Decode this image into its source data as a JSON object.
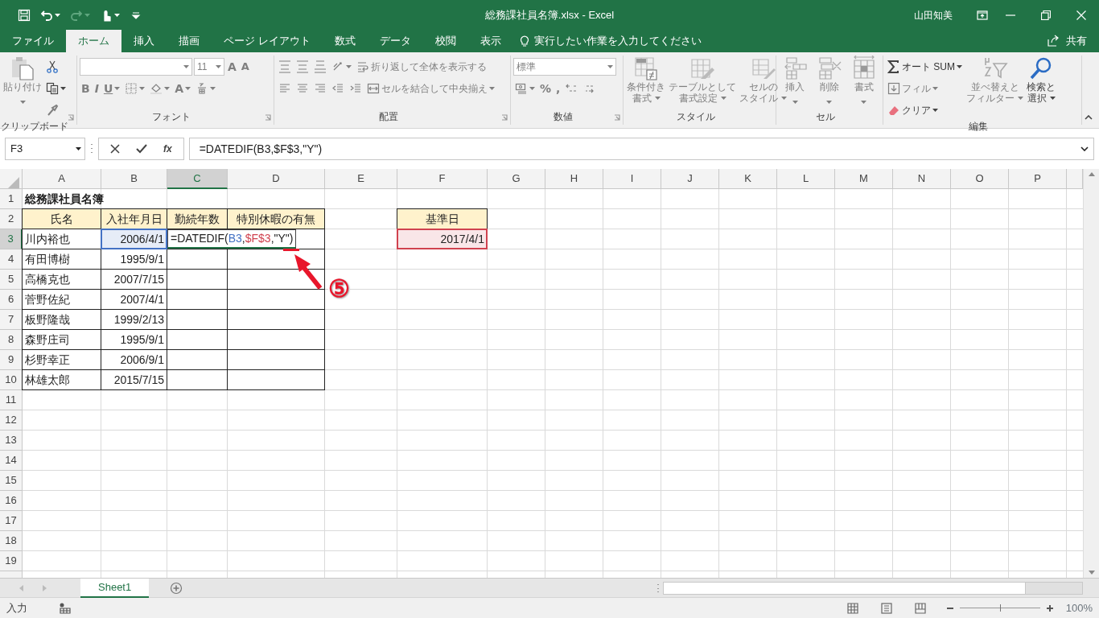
{
  "window": {
    "title": "総務課社員名簿.xlsx  -  Excel",
    "user": "山田知美"
  },
  "quick_access": [
    {
      "kind": "save",
      "disabled": false
    },
    {
      "kind": "undo",
      "dropdown": true,
      "disabled": false
    },
    {
      "kind": "redo",
      "dropdown": true,
      "disabled": true
    },
    {
      "kind": "touch",
      "dropdown": true,
      "disabled": false
    },
    {
      "kind": "customize",
      "disabled": false
    }
  ],
  "tabs": [
    {
      "label": "ファイル",
      "selected": false
    },
    {
      "label": "ホーム",
      "selected": true
    },
    {
      "label": "挿入",
      "selected": false
    },
    {
      "label": "描画",
      "selected": false
    },
    {
      "label": "ページ レイアウト",
      "selected": false
    },
    {
      "label": "数式",
      "selected": false
    },
    {
      "label": "データ",
      "selected": false
    },
    {
      "label": "校閲",
      "selected": false
    },
    {
      "label": "表示",
      "selected": false
    }
  ],
  "tell_me": {
    "placeholder": "実行したい作業を入力してください"
  },
  "share": {
    "label": "共有"
  },
  "ribbon": {
    "groups": [
      {
        "label": "クリップボード",
        "launcher": true,
        "blocks": [
          {
            "kind": "large",
            "button": {
              "kind": "paste",
              "lines": [
                "貼り付け"
              ],
              "dropdown": true,
              "disabled": true
            }
          },
          {
            "kind": "stack",
            "rows": [
              [
                {
                  "kind": "cut",
                  "disabled": false
                }
              ],
              [
                {
                  "kind": "copy",
                  "dropdown": true,
                  "disabled": false
                }
              ],
              [
                {
                  "kind": "format_painter",
                  "disabled": true
                }
              ]
            ]
          }
        ]
      },
      {
        "label": "フォント",
        "launcher": true,
        "blocks": [
          {
            "kind": "stack",
            "rows": [
              [
                {
                  "kind": "font_combo",
                  "disabled": true
                },
                {
                  "kind": "size_combo",
                  "value": "11",
                  "disabled": true
                },
                {
                  "kind": "grow",
                  "label": "A",
                  "disabled": true
                },
                {
                  "kind": "shrink",
                  "label": "A",
                  "disabled": true
                }
              ],
              [
                {
                  "kind": "bold",
                  "label": "B",
                  "disabled": true
                },
                {
                  "kind": "italic",
                  "label": "I",
                  "disabled": true
                },
                {
                  "kind": "underline",
                  "label": "U",
                  "dropdown": true,
                  "disabled": true
                },
                {
                  "kind": "border",
                  "dropdown": true,
                  "disabled": true
                },
                {
                  "kind": "fill",
                  "dropdown": true,
                  "disabled": true
                },
                {
                  "kind": "font_color",
                  "label": "A",
                  "dropdown": true,
                  "disabled": true
                },
                {
                  "kind": "phonetic",
                  "dropdown": true,
                  "disabled": true
                }
              ]
            ]
          }
        ]
      },
      {
        "label": "配置",
        "launcher": true,
        "blocks": [
          {
            "kind": "stack",
            "rows": [
              [
                {
                  "kind": "align_top",
                  "disabled": true
                },
                {
                  "kind": "align_middle",
                  "disabled": true
                },
                {
                  "kind": "align_bottom",
                  "disabled": true
                },
                {
                  "kind": "orientation",
                  "dropdown": true,
                  "disabled": true
                },
                {
                  "kind": "wrap",
                  "label": "折り返して全体を表示する",
                  "disabled": true
                }
              ],
              [
                {
                  "kind": "align_left",
                  "disabled": true
                },
                {
                  "kind": "align_center",
                  "disabled": true
                },
                {
                  "kind": "align_right",
                  "disabled": true
                },
                {
                  "kind": "indent_dec",
                  "disabled": true
                },
                {
                  "kind": "indent_inc",
                  "disabled": true
                },
                {
                  "kind": "merge",
                  "label": "セルを結合して中央揃え",
                  "dropdown": true,
                  "disabled": true
                }
              ]
            ]
          }
        ]
      },
      {
        "label": "数値",
        "launcher": true,
        "blocks": [
          {
            "kind": "stack",
            "rows": [
              [
                {
                  "kind": "format_combo",
                  "value": "標準",
                  "disabled": true
                }
              ],
              [
                {
                  "kind": "currency",
                  "dropdown": true,
                  "disabled": true
                },
                {
                  "kind": "percent",
                  "label": "%",
                  "disabled": true
                },
                {
                  "kind": "comma",
                  "label": ",",
                  "disabled": true
                },
                {
                  "kind": "dec_inc",
                  "disabled": true
                },
                {
                  "kind": "dec_dec",
                  "disabled": true
                }
              ]
            ]
          }
        ]
      },
      {
        "label": "スタイル",
        "blocks": [
          {
            "kind": "large",
            "button": {
              "kind": "conditional",
              "lines": [
                "条件付き",
                "書式"
              ],
              "dropdown": true,
              "disabled": true
            }
          },
          {
            "kind": "large",
            "button": {
              "kind": "table",
              "lines": [
                "テーブルとして",
                "書式設定"
              ],
              "dropdown": true,
              "disabled": true
            }
          },
          {
            "kind": "large",
            "button": {
              "kind": "cell_styles",
              "lines": [
                "セルの",
                "スタイル"
              ],
              "dropdown": true,
              "disabled": true
            }
          }
        ]
      },
      {
        "label": "セル",
        "blocks": [
          {
            "kind": "large",
            "button": {
              "kind": "insert",
              "lines": [
                "挿入"
              ],
              "dropdown": true,
              "disabled": true
            }
          },
          {
            "kind": "large",
            "button": {
              "kind": "delete",
              "lines": [
                "削除"
              ],
              "dropdown": true,
              "disabled": true
            }
          },
          {
            "kind": "large",
            "button": {
              "kind": "format",
              "lines": [
                "書式"
              ],
              "dropdown": true,
              "disabled": true
            }
          }
        ]
      },
      {
        "label": "編集",
        "blocks": [
          {
            "kind": "stack",
            "rows": [
              [
                {
                  "kind": "autosum",
                  "label": "オート SUM",
                  "dropdown": true,
                  "disabled": false
                }
              ],
              [
                {
                  "kind": "fill_down",
                  "label": "フィル",
                  "dropdown": true,
                  "disabled": true
                }
              ],
              [
                {
                  "kind": "clear",
                  "label": "クリア",
                  "dropdown": true,
                  "disabled": false
                }
              ]
            ]
          },
          {
            "kind": "large",
            "button": {
              "kind": "sort",
              "lines": [
                "並べ替えと",
                "フィルター"
              ],
              "dropdown": true,
              "disabled": true
            }
          },
          {
            "kind": "large",
            "button": {
              "kind": "find",
              "lines": [
                "検索と",
                "選択"
              ],
              "dropdown": true,
              "disabled": false
            }
          }
        ]
      }
    ]
  },
  "formula_bar": {
    "name_box": "F3",
    "function_label": "fx",
    "formula": "=DATEDIF(B3,$F$3,\"Y\")"
  },
  "sheet": {
    "columns": [
      {
        "label": "A",
        "selected": false
      },
      {
        "label": "B",
        "selected": false
      },
      {
        "label": "C",
        "selected": true
      },
      {
        "label": "D",
        "selected": false
      },
      {
        "label": "E",
        "selected": false
      },
      {
        "label": "F",
        "selected": false
      },
      {
        "label": "G",
        "selected": false
      },
      {
        "label": "H",
        "selected": false
      },
      {
        "label": "I",
        "selected": false
      },
      {
        "label": "J",
        "selected": false
      },
      {
        "label": "K",
        "selected": false
      },
      {
        "label": "L",
        "selected": false
      },
      {
        "label": "M",
        "selected": false
      },
      {
        "label": "N",
        "selected": false
      },
      {
        "label": "O",
        "selected": false
      },
      {
        "label": "P",
        "selected": false
      }
    ],
    "rows": [
      {
        "label": "1",
        "selected": false,
        "cells": [
          {
            "kind": "title",
            "text": "総務課社員名簿"
          }
        ]
      },
      {
        "label": "2",
        "selected": false,
        "cells": [
          {
            "kind": "header",
            "text": "氏名"
          },
          {
            "kind": "header",
            "text": "入社年月日"
          },
          {
            "kind": "header",
            "text": "勤続年数"
          },
          {
            "kind": "header",
            "text": "特別休暇の有無"
          },
          {
            "kind": "empty"
          },
          {
            "kind": "header",
            "text": "基準日"
          }
        ]
      },
      {
        "label": "3",
        "selected": true,
        "cells": [
          {
            "kind": "text",
            "text": "川内裕也"
          },
          {
            "kind": "number",
            "text": "2006/4/1",
            "color": "#4472c4"
          },
          {
            "kind": "editor",
            "parts": [
              {
                "text": "=DATEDIF("
              },
              {
                "text": "B3",
                "color": "#4472c4"
              },
              {
                "text": ","
              },
              {
                "text": "$F$3",
                "color": "#d0424f"
              },
              {
                "text": ",\"Y\")"
              }
            ]
          },
          {
            "kind": "blank"
          },
          {
            "kind": "empty"
          },
          {
            "kind": "number",
            "text": "2017/4/1",
            "color": "#d0424f"
          }
        ]
      },
      {
        "label": "4",
        "selected": false,
        "cells": [
          {
            "kind": "text",
            "text": "有田博樹"
          },
          {
            "kind": "number",
            "text": "1995/9/1"
          },
          {
            "kind": "blank"
          },
          {
            "kind": "blank"
          }
        ]
      },
      {
        "label": "5",
        "selected": false,
        "cells": [
          {
            "kind": "text",
            "text": "高橋克也"
          },
          {
            "kind": "number",
            "text": "2007/7/15"
          },
          {
            "kind": "blank"
          },
          {
            "kind": "blank"
          }
        ]
      },
      {
        "label": "6",
        "selected": false,
        "cells": [
          {
            "kind": "text",
            "text": "菅野佐紀"
          },
          {
            "kind": "number",
            "text": "2007/4/1"
          },
          {
            "kind": "blank"
          },
          {
            "kind": "blank"
          }
        ]
      },
      {
        "label": "7",
        "selected": false,
        "cells": [
          {
            "kind": "text",
            "text": "板野隆哉"
          },
          {
            "kind": "number",
            "text": "1999/2/13"
          },
          {
            "kind": "blank"
          },
          {
            "kind": "blank"
          }
        ]
      },
      {
        "label": "8",
        "selected": false,
        "cells": [
          {
            "kind": "text",
            "text": "森野庄司"
          },
          {
            "kind": "number",
            "text": "1995/9/1"
          },
          {
            "kind": "blank"
          },
          {
            "kind": "blank"
          }
        ]
      },
      {
        "label": "9",
        "selected": false,
        "cells": [
          {
            "kind": "text",
            "text": "杉野幸正"
          },
          {
            "kind": "number",
            "text": "2006/9/1"
          },
          {
            "kind": "blank"
          },
          {
            "kind": "blank"
          }
        ]
      },
      {
        "label": "10",
        "selected": false,
        "cells": [
          {
            "kind": "text",
            "text": "林雄太郎"
          },
          {
            "kind": "number",
            "text": "2015/7/15"
          },
          {
            "kind": "blank"
          },
          {
            "kind": "blank"
          }
        ]
      },
      {
        "label": "11",
        "selected": false
      },
      {
        "label": "12",
        "selected": false
      },
      {
        "label": "13",
        "selected": false
      },
      {
        "label": "14",
        "selected": false
      },
      {
        "label": "15",
        "selected": false
      },
      {
        "label": "16",
        "selected": false
      },
      {
        "label": "17",
        "selected": false
      },
      {
        "label": "18",
        "selected": false
      },
      {
        "label": "19",
        "selected": false
      }
    ]
  },
  "annotation": {
    "label": "⑤"
  },
  "sheet_tabs": [
    {
      "label": "Sheet1",
      "selected": true
    }
  ],
  "status_bar": {
    "mode": "入力",
    "zoom_slider": {
      "level": 0.5
    },
    "zoom": "100%"
  }
}
